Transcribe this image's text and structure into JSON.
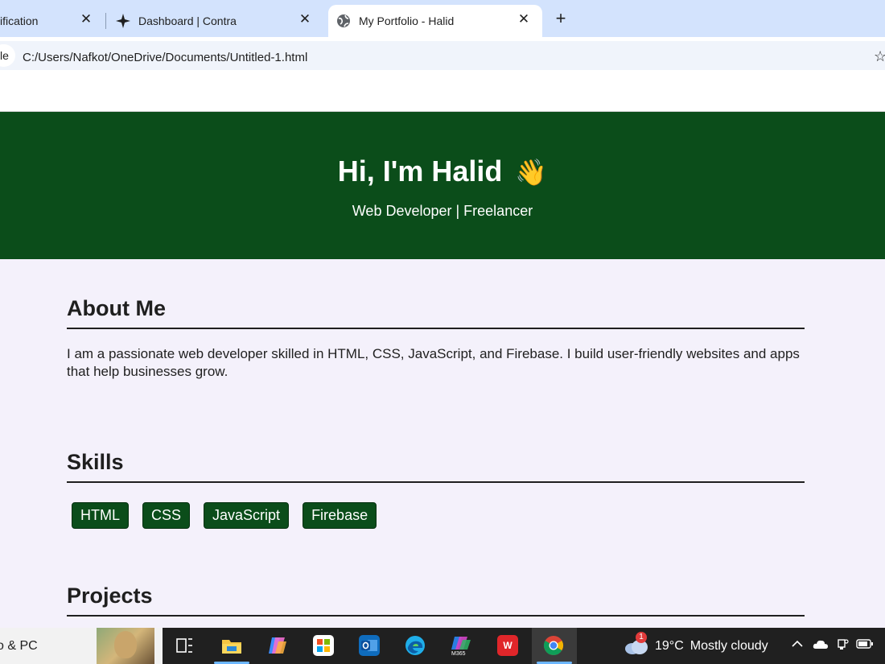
{
  "browser": {
    "tabs": [
      {
        "title": "ification",
        "icon": "page-icon"
      },
      {
        "title": "Dashboard | Contra",
        "icon": "contra-star-icon"
      },
      {
        "title": "My Portfolio - Halid",
        "icon": "globe-icon",
        "active": true
      }
    ],
    "close_glyph": "✕",
    "new_tab_glyph": "+",
    "address_chip": "le",
    "url": "C:/Users/Nafkot/OneDrive/Documents/Untitled-1.html"
  },
  "page": {
    "hero": {
      "title": "Hi, I'm Halid",
      "emoji": "👋",
      "subtitle": "Web Developer | Freelancer"
    },
    "about": {
      "heading": "About Me",
      "text": "I am a passionate web developer skilled in HTML, CSS, JavaScript, and Firebase. I build user-friendly websites and apps that help businesses grow."
    },
    "skills": {
      "heading": "Skills",
      "items": [
        "HTML",
        "CSS",
        "JavaScript",
        "Firebase"
      ]
    },
    "projects": {
      "heading": "Projects"
    }
  },
  "taskbar": {
    "search_text": "o & PC",
    "apps": [
      "task-view-icon",
      "file-explorer-icon",
      "copilot-icon",
      "microsoft-store-icon",
      "outlook-icon",
      "edge-icon",
      "m365-icon",
      "wps-office-icon",
      "chrome-icon"
    ],
    "m365_label": "M365",
    "wps_label": "W",
    "weather": {
      "badge": "1",
      "temperature": "19°C",
      "condition": "Mostly cloudy"
    }
  },
  "colors": {
    "hero_bg": "#0b4d1a",
    "page_bg": "#f4f1fb",
    "tab_strip": "#d3e3fd"
  }
}
